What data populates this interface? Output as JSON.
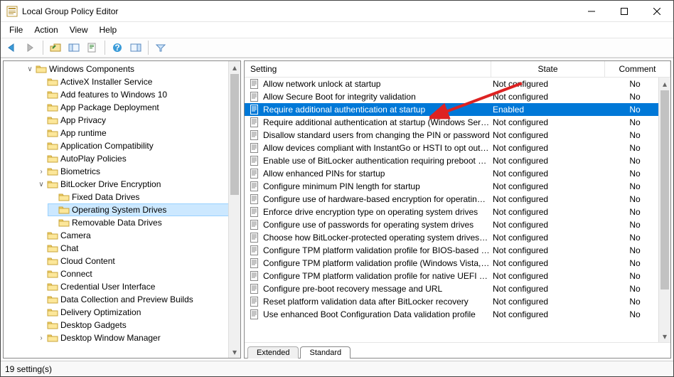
{
  "window": {
    "title": "Local Group Policy Editor"
  },
  "menubar": [
    "File",
    "Action",
    "View",
    "Help"
  ],
  "toolbar_icons": [
    "back",
    "forward",
    "up",
    "show-hide",
    "properties",
    "export",
    "help",
    "show-hide-action",
    "filter"
  ],
  "tree": {
    "root_label": "Windows Components",
    "selected": "Operating System Drives",
    "items": [
      {
        "label": "ActiveX Installer Service"
      },
      {
        "label": "Add features to Windows 10"
      },
      {
        "label": "App Package Deployment"
      },
      {
        "label": "App Privacy"
      },
      {
        "label": "App runtime"
      },
      {
        "label": "Application Compatibility"
      },
      {
        "label": "AutoPlay Policies"
      },
      {
        "label": "Biometrics",
        "expander": ">"
      },
      {
        "label": "BitLocker Drive Encryption",
        "expander": "v",
        "children": [
          {
            "label": "Fixed Data Drives"
          },
          {
            "label": "Operating System Drives",
            "selected": true
          },
          {
            "label": "Removable Data Drives"
          }
        ]
      },
      {
        "label": "Camera"
      },
      {
        "label": "Chat"
      },
      {
        "label": "Cloud Content"
      },
      {
        "label": "Connect"
      },
      {
        "label": "Credential User Interface"
      },
      {
        "label": "Data Collection and Preview Builds"
      },
      {
        "label": "Delivery Optimization"
      },
      {
        "label": "Desktop Gadgets"
      },
      {
        "label": "Desktop Window Manager",
        "expander": ">"
      }
    ]
  },
  "columns": {
    "setting": "Setting",
    "state": "State",
    "comment": "Comment"
  },
  "rows": [
    {
      "setting": "Allow network unlock at startup",
      "state": "Not configured",
      "comment": "No"
    },
    {
      "setting": "Allow Secure Boot for integrity validation",
      "state": "Not configured",
      "comment": "No"
    },
    {
      "setting": "Require additional authentication at startup",
      "state": "Enabled",
      "comment": "No",
      "selected": true
    },
    {
      "setting": "Require additional authentication at startup (Windows Serve...",
      "state": "Not configured",
      "comment": "No"
    },
    {
      "setting": "Disallow standard users from changing the PIN or password",
      "state": "Not configured",
      "comment": "No"
    },
    {
      "setting": "Allow devices compliant with InstantGo or HSTI to opt out o...",
      "state": "Not configured",
      "comment": "No"
    },
    {
      "setting": "Enable use of BitLocker authentication requiring preboot ke...",
      "state": "Not configured",
      "comment": "No"
    },
    {
      "setting": "Allow enhanced PINs for startup",
      "state": "Not configured",
      "comment": "No"
    },
    {
      "setting": "Configure minimum PIN length for startup",
      "state": "Not configured",
      "comment": "No"
    },
    {
      "setting": "Configure use of hardware-based encryption for operating s...",
      "state": "Not configured",
      "comment": "No"
    },
    {
      "setting": "Enforce drive encryption type on operating system drives",
      "state": "Not configured",
      "comment": "No"
    },
    {
      "setting": "Configure use of passwords for operating system drives",
      "state": "Not configured",
      "comment": "No"
    },
    {
      "setting": "Choose how BitLocker-protected operating system drives ca...",
      "state": "Not configured",
      "comment": "No"
    },
    {
      "setting": "Configure TPM platform validation profile for BIOS-based fir...",
      "state": "Not configured",
      "comment": "No"
    },
    {
      "setting": "Configure TPM platform validation profile (Windows Vista, ...",
      "state": "Not configured",
      "comment": "No"
    },
    {
      "setting": "Configure TPM platform validation profile for native UEFI fir...",
      "state": "Not configured",
      "comment": "No"
    },
    {
      "setting": "Configure pre-boot recovery message and URL",
      "state": "Not configured",
      "comment": "No"
    },
    {
      "setting": "Reset platform validation data after BitLocker recovery",
      "state": "Not configured",
      "comment": "No"
    },
    {
      "setting": "Use enhanced Boot Configuration Data validation profile",
      "state": "Not configured",
      "comment": "No"
    }
  ],
  "tabs": {
    "extended": "Extended",
    "standard": "Standard",
    "active": "Standard"
  },
  "statusbar": "19 setting(s)"
}
